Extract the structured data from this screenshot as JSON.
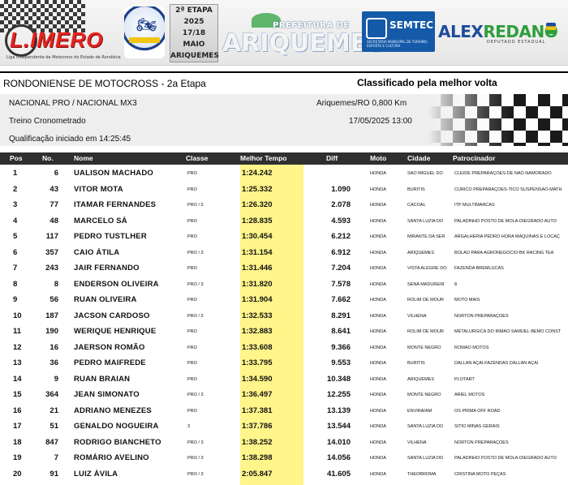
{
  "banner": {
    "league_logo": "L.IMERO",
    "league_subtitle": "Liga Independente de Motocross do Estado de Rondônia",
    "etapa_label": "2ª ETAPA",
    "etapa_year": "2025",
    "etapa_dates": "17/18 MAIO",
    "etapa_city": "ARIQUEMES",
    "prefeitura_label": "PREFEITURA DE",
    "prefeitura_city": "ARIQUEMES",
    "semtec_name": "SEMTEC",
    "semtec_subtitle": "SECRETARIA MUNICIPAL DE TURISMO, ESPORTE E CULTURA",
    "alex_name_a": "ALEX",
    "alex_name_b": "REDANO",
    "alex_subtitle": "DEPUTADO ESTADUAL"
  },
  "event": {
    "name": "RONDONIENSE DE MOTOCROSS - 2a Etapa",
    "classification": "Classificado pela melhor volta",
    "category": "NACIONAL PRO / NACIONAL MX3",
    "session": "Treino Cronometrado",
    "started": "Qualificação iniciado em 14:25:45",
    "venue": "Ariquemes/RO 0,800 Km",
    "datetime": "17/05/2025 13:00"
  },
  "table": {
    "headers": {
      "pos": "Pos",
      "no": "No.",
      "name": "Nome",
      "class": "Classe",
      "best": "Melhor Tempo",
      "diff": "Diff",
      "moto": "Moto",
      "city": "Cidade",
      "sponsor": "Patrocinador"
    },
    "rows": [
      {
        "pos": "1",
        "no": "6",
        "name": "UALISON MACHADO",
        "cls": "PRO",
        "time": "1:24.242",
        "diff": "",
        "moto": "HONDA",
        "city": "SÃO MIGUEL DO",
        "sponsor": "CLEIDE PREPARAÇÕES-DE NÃO NAMORADO"
      },
      {
        "pos": "2",
        "no": "43",
        "name": "VITOR MOTA",
        "cls": "PRO",
        "time": "1:25.332",
        "diff": "1.090",
        "moto": "HONDA",
        "city": "BURITIS",
        "sponsor": "CURICO PREPARAÇÕES-TICO SUSPENSÃO-MATH"
      },
      {
        "pos": "3",
        "no": "77",
        "name": "ITAMAR FERNANDES",
        "cls": "PRO / 3",
        "time": "1:26.320",
        "diff": "2.078",
        "moto": "HONDA",
        "city": "CACOAL",
        "sponsor": "ITP MULTIMARCAS"
      },
      {
        "pos": "4",
        "no": "48",
        "name": "MARCELO SÁ",
        "cls": "PRO",
        "time": "1:28.835",
        "diff": "4.593",
        "moto": "HONDA",
        "city": "SANTA LUZIA DO",
        "sponsor": "PALADINHO POSTO DE MOLA-DIEGRADO AUTO"
      },
      {
        "pos": "5",
        "no": "117",
        "name": "PEDRO TUSTLHER",
        "cls": "PRO",
        "time": "1:30.454",
        "diff": "6.212",
        "moto": "HONDA",
        "city": "MIRANTE DA SER",
        "sponsor": "ARGALHERIA PEDRO HORA MÁQUINAS E LOCAÇ"
      },
      {
        "pos": "6",
        "no": "357",
        "name": "CAIO ÁTILA",
        "cls": "PRO / 3",
        "time": "1:31.154",
        "diff": "6.912",
        "moto": "HONDA",
        "city": "ARIQUEMES",
        "sponsor": "BOLÃO PARA AGRONEGÓCIO-BK RACING TEA"
      },
      {
        "pos": "7",
        "no": "243",
        "name": "JAIR FERNANDO",
        "cls": "PRO",
        "time": "1:31.446",
        "diff": "7.204",
        "moto": "HONDA",
        "city": "VISTA ALEGRE DO",
        "sponsor": "FAZENDA BREMLUCAS"
      },
      {
        "pos": "8",
        "no": "8",
        "name": "ENDERSON OLIVEIRA",
        "cls": "PRO / 3",
        "time": "1:31.820",
        "diff": "7.578",
        "moto": "HONDA",
        "city": "SENA MADUREIR",
        "sponsor": "8"
      },
      {
        "pos": "9",
        "no": "56",
        "name": "RUAN OLIVEIRA",
        "cls": "PRO",
        "time": "1:31.904",
        "diff": "7.662",
        "moto": "HONDA",
        "city": "ROLIM DE MOUR",
        "sponsor": "MOTO MAIS"
      },
      {
        "pos": "10",
        "no": "187",
        "name": "JACSON CARDOSO",
        "cls": "PRO / 3",
        "time": "1:32.533",
        "diff": "8.291",
        "moto": "HONDA",
        "city": "VILHENA",
        "sponsor": "NORTON PREPARAÇÕES"
      },
      {
        "pos": "11",
        "no": "190",
        "name": "WERIQUE HENRIQUE",
        "cls": "PRO",
        "time": "1:32.883",
        "diff": "8.641",
        "moto": "HONDA",
        "city": "ROLIM DE MOUR",
        "sponsor": "METALÚRGICA DO IRMÃO SAMUEL-BEMO CONST"
      },
      {
        "pos": "12",
        "no": "16",
        "name": "JAERSON ROMÃO",
        "cls": "PRO",
        "time": "1:33.608",
        "diff": "9.366",
        "moto": "HONDA",
        "city": "MONTE NEGRO",
        "sponsor": "ROMÃO MOTOS"
      },
      {
        "pos": "13",
        "no": "36",
        "name": "PEDRO MAIFREDE",
        "cls": "PRO",
        "time": "1:33.795",
        "diff": "9.553",
        "moto": "HONDA",
        "city": "BURITIS",
        "sponsor": "DALLAN AÇAÍ-FAZENDAS DALLAN AÇAÍ"
      },
      {
        "pos": "14",
        "no": "9",
        "name": "RUAN BRAIAN",
        "cls": "PRO",
        "time": "1:34.590",
        "diff": "10.348",
        "moto": "HONDA",
        "city": "ARIQUEMES",
        "sponsor": "PLOTART"
      },
      {
        "pos": "15",
        "no": "364",
        "name": "JEAN SIMONATO",
        "cls": "PRO / 3",
        "time": "1:36.497",
        "diff": "12.255",
        "moto": "HONDA",
        "city": "MONTE NEGRO",
        "sponsor": "ARIEL MOTOS"
      },
      {
        "pos": "16",
        "no": "21",
        "name": "ADRIANO MENEZES",
        "cls": "PRO",
        "time": "1:37.381",
        "diff": "13.139",
        "moto": "HONDA",
        "city": "ENVIRA/AM",
        "sponsor": "OS PRIMA OFF ROAD"
      },
      {
        "pos": "17",
        "no": "51",
        "name": "GENALDO NOGUEIRA",
        "cls": "3",
        "time": "1:37.786",
        "diff": "13.544",
        "moto": "HONDA",
        "city": "SANTA LUZIA DO",
        "sponsor": "SÍTIO MINAS GERAIS"
      },
      {
        "pos": "18",
        "no": "847",
        "name": "RODRIGO BIANCHETO",
        "cls": "PRO / 3",
        "time": "1:38.252",
        "diff": "14.010",
        "moto": "HONDA",
        "city": "VILHENA",
        "sponsor": "NORTON PREPARAÇÕES"
      },
      {
        "pos": "19",
        "no": "7",
        "name": "ROMÁRIO AVELINO",
        "cls": "PRO / 3",
        "time": "1:38.298",
        "diff": "14.056",
        "moto": "HONDA",
        "city": "SANTA LUZIA DO",
        "sponsor": "PALADINHO POSTO DE MOLA-DIEGRADO AUTO"
      },
      {
        "pos": "20",
        "no": "91",
        "name": "LUIZ ÁVILA",
        "cls": "PRO / 3",
        "time": "2:05.847",
        "diff": "41.605",
        "moto": "HONDA",
        "city": "THEOBROMA",
        "sponsor": "CRISTINA MOTO PEÇAS"
      }
    ]
  },
  "colors": {
    "best_time_highlight": "#fff58a",
    "header_bg": "#2f2f2f",
    "limero_red": "#e8231f",
    "semtec_blue": "#155aa8",
    "alex_blue": "#1f4c9a",
    "alex_green": "#2f9e3d"
  }
}
